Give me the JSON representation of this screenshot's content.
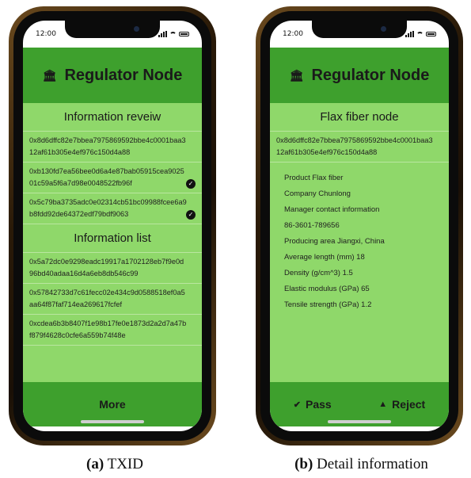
{
  "left_phone": {
    "status_time": "12:00",
    "header_title": "Regulator Node",
    "section1_title": "Information reveiw",
    "review_items": [
      {
        "text": "0x8d6dffc82e7bbea7975869592bbe4c0001baa312af61b305e4ef976c150d4a88",
        "checked": false
      },
      {
        "text": "0xb130fd7ea56bee0d6a4e87bab05915cea902501c59a5f6a7d98e0048522fb96f",
        "checked": true
      },
      {
        "text": "0x5c79ba3735adc0e02314cb51bc09988fcee6a9b8fdd92de64372edf79bdf9063",
        "checked": true
      }
    ],
    "section2_title": "Information list",
    "list_items": [
      "0x5a72dc0e9298eadc19917a1702128eb7f9e0d96bd40adaa16d4a6eb8db546c99",
      "0x57842733d7c61fecc02e434c9d0588518ef0a5aa64f87faf714ea269617fcfef",
      "0xcdea6b3b8407f1e98b17fe0e1873d2a2d7a47bf879f4628c0cfe6a559b74f48e"
    ],
    "footer_button": "More",
    "caption_letter": "(a)",
    "caption_text": "TXID"
  },
  "right_phone": {
    "status_time": "12:00",
    "header_title": "Regulator Node",
    "section_title": "Flax fiber node",
    "hash": "0x8d6dffc82e7bbea7975869592bbe4c0001baa312af61b305e4ef976c150d4a88",
    "details": [
      "Product    Flax fiber",
      "Company   Chunlong",
      "Manager contact information",
      "86-3601-789656",
      "Producing area   Jiangxi, China",
      "Average length (mm)   18",
      "Density (g/cm^3)   1.5",
      "Elastic modulus (GPa)  65",
      "Tensile strength (GPa)   1.2"
    ],
    "pass_label": "Pass",
    "reject_label": "Reject",
    "caption_letter": "(b)",
    "caption_text": "Detail information"
  },
  "colors": {
    "header_green": "#3ea02d",
    "content_green": "#8fd86a"
  }
}
